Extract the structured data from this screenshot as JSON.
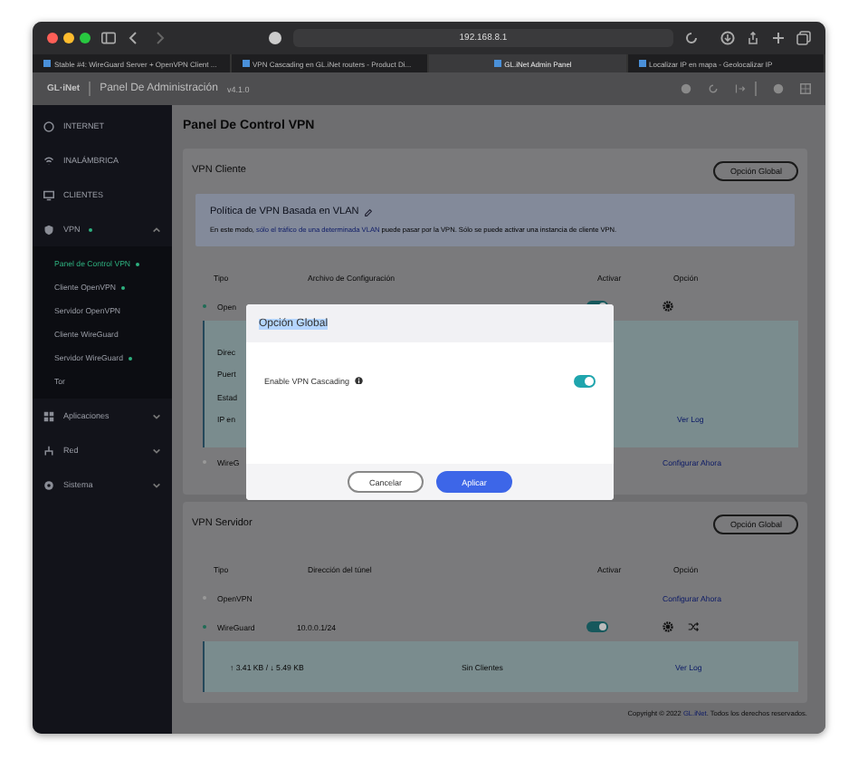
{
  "browser": {
    "url": "192.168.8.1",
    "tabs": [
      {
        "title": "Stable #4: WireGuard Server + OpenVPN Client ...",
        "selected": false
      },
      {
        "title": "VPN Cascading en GL.iNet routers - Product Di...",
        "selected": false
      },
      {
        "title": "GL.iNet Admin Panel",
        "selected": true
      },
      {
        "title": "Localizar IP en mapa - Geolocalizar IP",
        "selected": false
      }
    ]
  },
  "header": {
    "logo": "GL·iNet",
    "title": "Panel De Administración",
    "version": "v4.1.0"
  },
  "sidebar": {
    "items": [
      {
        "label": "INTERNET",
        "status_dot": false
      },
      {
        "label": "INALÁMBRICA",
        "status_dot": false
      },
      {
        "label": "CLIENTES",
        "status_dot": false
      },
      {
        "label": "VPN",
        "status_dot": true,
        "expanded": true,
        "children": [
          {
            "label": "Panel de Control VPN",
            "selected": true,
            "status_dot": true
          },
          {
            "label": "Cliente OpenVPN",
            "selected": false,
            "status_dot": true
          },
          {
            "label": "Servidor OpenVPN",
            "selected": false,
            "status_dot": false
          },
          {
            "label": "Cliente WireGuard",
            "selected": false,
            "status_dot": false
          },
          {
            "label": "Servidor WireGuard",
            "selected": false,
            "status_dot": true
          },
          {
            "label": "Tor",
            "selected": false,
            "status_dot": false
          }
        ]
      },
      {
        "label": "Aplicaciones",
        "status_dot": false,
        "expanded": false
      },
      {
        "label": "Red",
        "status_dot": false,
        "expanded": false
      },
      {
        "label": "Sistema",
        "status_dot": false,
        "expanded": false
      }
    ]
  },
  "page_title": "Panel De Control VPN",
  "client": {
    "title": "VPN Cliente",
    "button": "Opción Global",
    "policy": {
      "title": "Política de VPN Basada en VLAN",
      "text_before": "En este modo,",
      "link": "sólo el tráfico de una determinada VLAN",
      "text_after": "puede pasar por la VPN. Sólo se puede activar una instancia de cliente VPN."
    },
    "columns": [
      "Tipo",
      "Archivo de Configuración",
      "Activar",
      "Opción"
    ],
    "rows": [
      {
        "kind": "configured",
        "type": "Open",
        "status_dot": true,
        "enabled": true,
        "details": [
          "Direc",
          "Puert",
          "Estad",
          "IP en"
        ],
        "log_link": "Ver Log"
      },
      {
        "kind": "unconfigured",
        "type": "WireG",
        "status_dot": false,
        "link": "Configurar Ahora"
      }
    ]
  },
  "server": {
    "title": "VPN Servidor",
    "button": "Opción Global",
    "columns": [
      "Tipo",
      "Dirección del túnel",
      "Activar",
      "Opción"
    ],
    "rows": [
      {
        "kind": "unconfigured",
        "type": "OpenVPN",
        "status_dot": false,
        "link": "Configurar Ahora"
      },
      {
        "kind": "configured",
        "type": "WireGuard",
        "status_dot": true,
        "address": "10.0.0.1/24",
        "enabled": true,
        "traffic": "↑ 3.41 KB / ↓ 5.49 KB",
        "clients": "Sin Clientes",
        "log_link": "Ver Log"
      }
    ]
  },
  "footer": {
    "text": "Copyright © 2022",
    "link": "GL.iNet",
    "text_after": ". Todos los derechos reservados."
  },
  "modal": {
    "title": "Opción Global",
    "title_selected": true,
    "option": {
      "label": "Enable VPN Cascading",
      "on": true
    },
    "buttons": [
      {
        "label": "Cancelar",
        "kind": "secondary"
      },
      {
        "label": "Aplicar",
        "kind": "primary"
      }
    ]
  }
}
